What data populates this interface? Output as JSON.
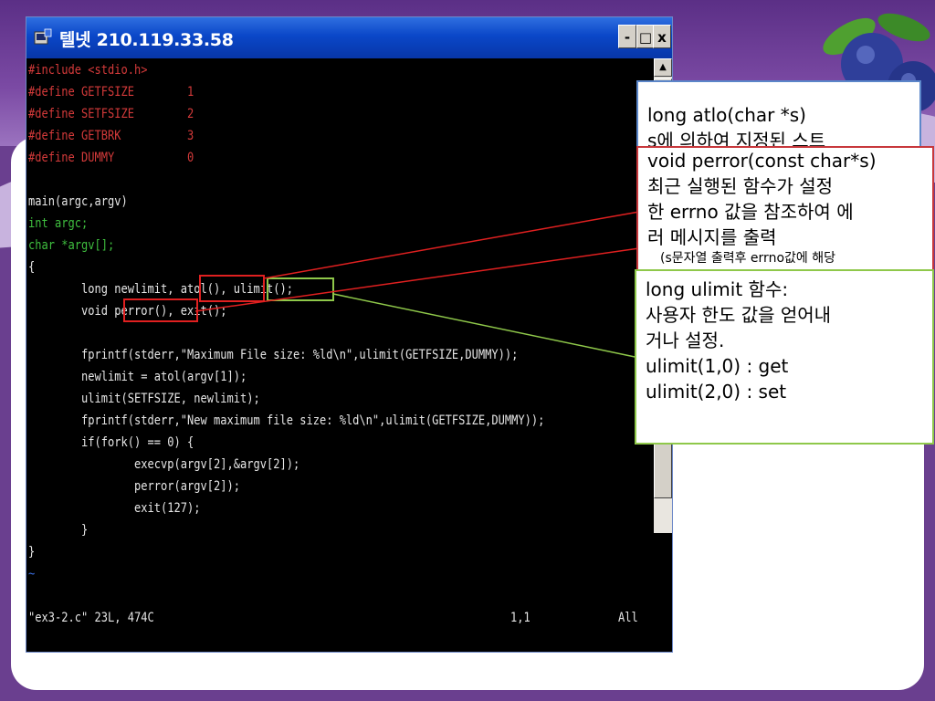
{
  "window": {
    "title": "텔넷 210.119.33.58",
    "buttons": {
      "minimize": "-",
      "maximize": "□",
      "close": "x"
    }
  },
  "terminal": {
    "lines": [
      "#include <stdio.h>",
      "#define GETFSIZE        1",
      "#define SETFSIZE        2",
      "#define GETBRK          3",
      "#define DUMMY           0",
      "",
      "main(argc,argv)",
      "int argc;",
      "char *argv[];",
      "{",
      "        long newlimit, atol(), ulimit();",
      "        void perror(), exit();",
      "",
      "        fprintf(stderr,\"Maximum File size: %ld\\n\",ulimit(GETFSIZE,DUMMY));",
      "        newlimit = atol(argv[1]);",
      "        ulimit(SETFSIZE, newlimit);",
      "        fprintf(stderr,\"New maximum file size: %ld\\n\",ulimit(GETFSIZE,DUMMY));",
      "        if(fork() == 0) {",
      "                execvp(argv[2],&argv[2]);",
      "                perror(argv[2]);",
      "                exit(127);",
      "        }",
      "}",
      "~"
    ],
    "status_file": "\"ex3-2.c\" 23L, 474C",
    "status_pos": "1,1",
    "status_all": "All"
  },
  "callouts": {
    "atol": {
      "line1": "long atlo(char *s)",
      "line2": "s에 의하여 지정된 스트"
    },
    "perror": {
      "line1": "void perror(const char*s)",
      "line2": "최근 실행된 함수가 설정",
      "line3": "한 errno 값을 참조하여 에",
      "line4": "러 메시지를 출력",
      "line5": "(s문자열 출력후 errno값에 해당"
    },
    "ulimit": {
      "line1": "long ulimit 함수:",
      "line2": "사용자 한도 값을 얻어내",
      "line3": "거나 설정.",
      "line4": "ulimit(1,0) : get",
      "line5": "ulimit(2,0) : set"
    }
  },
  "colors": {
    "highlight_red": "#e02020",
    "highlight_green": "#8fc84a",
    "titlebar": "#0a47c8"
  }
}
